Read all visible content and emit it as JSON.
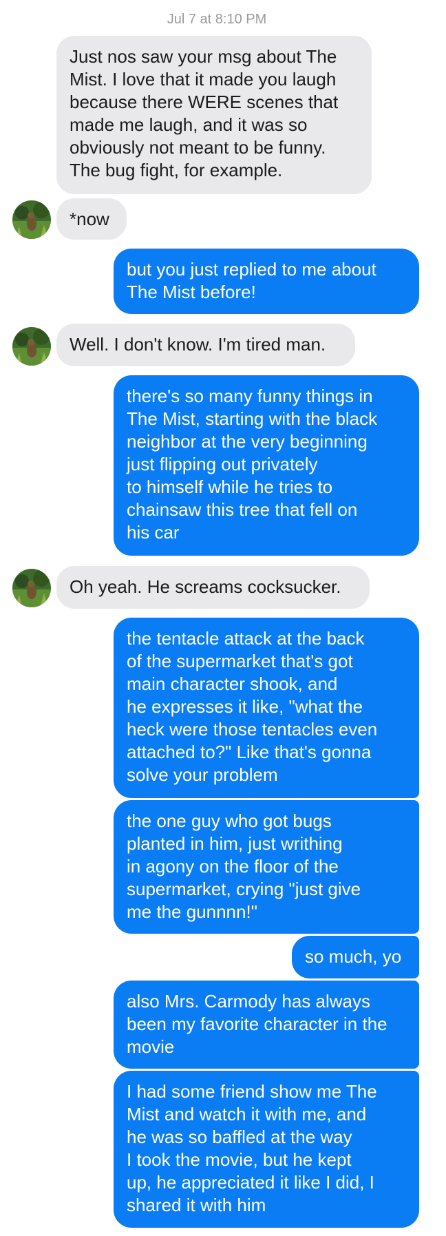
{
  "conversation": {
    "timestamp": "Jul 7 at 8:10 PM",
    "messages": [
      {
        "from": "them",
        "text": "Just nos saw your msg about The\nMist. I love that it made you laugh\nbecause there WERE scenes that\nmade me laugh, and it was so\nobviously not meant to be funny.\nThe bug fight, for example."
      },
      {
        "from": "them",
        "text": "*now"
      },
      {
        "from": "me",
        "text": "but you just replied to me about\nThe Mist before!"
      },
      {
        "from": "them",
        "text": "Well. I don't know. I'm tired man."
      },
      {
        "from": "me",
        "text": "there's so many funny things in\nThe Mist, starting with the black\nneighbor at the very beginning\njust flipping out privately\nto himself while he tries to\nchainsaw this tree that fell on\nhis car"
      },
      {
        "from": "them",
        "text": "Oh yeah. He screams cocksucker."
      },
      {
        "from": "me",
        "text": "the tentacle attack at the back\nof the supermarket that's got\nmain character shook, and\nhe expresses it like, \"what the\nheck were those tentacles even\nattached to?\" Like that's gonna\nsolve your problem"
      },
      {
        "from": "me",
        "text": "the one guy who got bugs\nplanted in him, just writhing\nin agony on the floor of the\nsupermarket, crying \"just give\nme the gunnnn!\""
      },
      {
        "from": "me",
        "text": "so much, yo"
      },
      {
        "from": "me",
        "text": "also Mrs. Carmody has always\nbeen my favorite character in the\nmovie"
      },
      {
        "from": "me",
        "text": "I had some friend show me The\nMist and watch it with me, and\nhe was so baffled at the way\nI took the movie, but he kept\nup, he appreciated it like I did, I\nshared it with him"
      }
    ]
  }
}
